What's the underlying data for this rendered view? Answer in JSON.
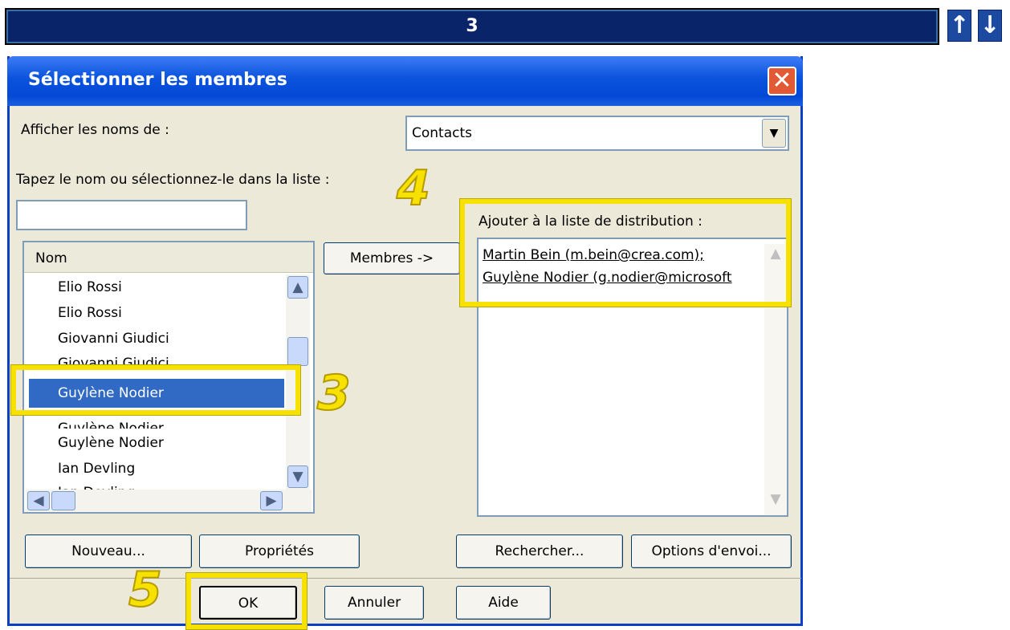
{
  "banner": {
    "step": "3",
    "up_icon": "↑",
    "down_icon": "↓"
  },
  "dialog": {
    "title": "Sélectionner les membres",
    "close_icon": "✕",
    "show_names_label": "Afficher les noms de :",
    "show_names_value": "Contacts",
    "type_name_label": "Tapez le nom ou sélectionnez-le dans la liste :",
    "type_name_value": "",
    "list_header": "Nom",
    "list_items": [
      "Elio Rossi",
      "Elio Rossi",
      "Giovanni Giudici",
      "Giovanni Giudici",
      "Guylène Nodier",
      "Guylène Nodier",
      "Guylène Nodier",
      "Ian Devling",
      "Ian Devling"
    ],
    "selected_index": 4,
    "members_button": "Membres ->",
    "distribution_label": "Ajouter à la liste de distribution :",
    "distribution_lines": [
      "Martin Bein (m.bein@crea.com);",
      "Guylène Nodier (g.nodier@microsoft"
    ],
    "buttons": {
      "new": "Nouveau...",
      "properties": "Propriétés",
      "find": "Rechercher...",
      "send_options": "Options d'envoi...",
      "ok": "OK",
      "cancel": "Annuler",
      "help": "Aide"
    }
  },
  "annotations": {
    "step3": "3",
    "step4": "4",
    "step5": "5"
  },
  "colors": {
    "highlight": "#f6e100",
    "titlebar": "#0a53de",
    "selection": "#316ac5"
  }
}
